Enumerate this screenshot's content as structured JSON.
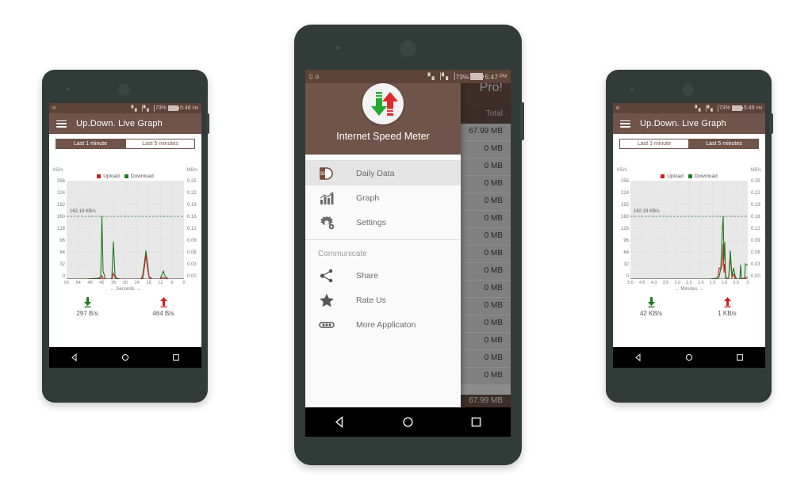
{
  "page": {
    "background": "#ffffff"
  },
  "colors": {
    "brand_brown": "#70544a",
    "status_brown": "#5d4338",
    "upload_red": "#cc2127",
    "download_green": "#1f7a1f",
    "plot_bg": "#e8e8e8",
    "phone_body": "#313b38"
  },
  "phones": [
    {
      "id": "left",
      "statusbar": {
        "battery_percent": "73%",
        "time": "5:48",
        "meridiem": "PM",
        "icons": [
          "upload-status-icon",
          "signal-icon",
          "signal-icon",
          "battery-icon"
        ]
      },
      "appbar": {
        "title": "Up.Down. Live Graph",
        "menu_icon": "hamburger-icon"
      },
      "tabs": [
        {
          "label": "Last 1 minute",
          "active": true
        },
        {
          "label": "Last 5 minutes",
          "active": false
        }
      ],
      "chart": {
        "left_unit": "KB/s",
        "right_unit": "MB/s",
        "legend": [
          {
            "label": "Upload",
            "color": "#cc2127"
          },
          {
            "label": "Download",
            "color": "#1f7a1f"
          }
        ],
        "peak_label": "162.19 KB/s",
        "xlabel": "← Seconds →",
        "y_left_ticks": [
          "256",
          "224",
          "192",
          "160",
          "128",
          "96",
          "64",
          "32",
          "0"
        ],
        "y_right_ticks": [
          "0.25",
          "0.22",
          "0.19",
          "0.16",
          "0.12",
          "0.09",
          "0.06",
          "0.03",
          "0.00"
        ],
        "x_ticks": [
          "60",
          "54",
          "48",
          "42",
          "36",
          "30",
          "24",
          "18",
          "12",
          "6",
          "0"
        ]
      },
      "stats": [
        {
          "kind": "download",
          "icon": "download-arrow-icon",
          "value": "297 B/s"
        },
        {
          "kind": "upload",
          "icon": "upload-arrow-icon",
          "value": "464 B/s"
        }
      ],
      "chart_data_ref": 0
    },
    {
      "id": "center",
      "statusbar": {
        "battery_percent": "73%",
        "time": "5:47",
        "meridiem": "PM",
        "icons": [
          "sd-card-icon",
          "upload-status-icon",
          "signal-icon",
          "signal-icon",
          "battery-icon"
        ]
      },
      "background_screen": {
        "appbar_title": "Pro!",
        "table_header": "Total",
        "rows": [
          "67.99 MB",
          "0 MB",
          "0 MB",
          "0 MB",
          "0 MB",
          "0 MB",
          "0 MB",
          "0 MB",
          "0 MB",
          "0 MB",
          "0 MB",
          "0 MB",
          "0 MB",
          "0 MB",
          "0 MB"
        ],
        "footer_total": "67.99 MB"
      },
      "drawer": {
        "logo_icon": "internet-speed-meter-logo",
        "title": "Internet Speed Meter",
        "items": [
          {
            "label": "Daily Data",
            "icon": "daily-data-icon",
            "selected": true
          },
          {
            "label": "Graph",
            "icon": "bar-chart-icon",
            "selected": false
          },
          {
            "label": "Settings",
            "icon": "gear-icon",
            "selected": false
          }
        ],
        "section_label": "Communicate",
        "communicate_items": [
          {
            "label": "Share",
            "icon": "share-icon"
          },
          {
            "label": "Rate Us",
            "icon": "star-icon"
          },
          {
            "label": "More Applicaton",
            "icon": "more-apps-icon"
          }
        ]
      }
    },
    {
      "id": "right",
      "statusbar": {
        "battery_percent": "73%",
        "time": "5:49",
        "meridiem": "PM",
        "icons": [
          "upload-status-icon",
          "signal-icon",
          "signal-icon",
          "battery-icon"
        ]
      },
      "appbar": {
        "title": "Up.Down. Live Graph",
        "menu_icon": "hamburger-icon"
      },
      "tabs": [
        {
          "label": "Last 1 minute",
          "active": false
        },
        {
          "label": "Last 5 minutes",
          "active": true
        }
      ],
      "chart": {
        "left_unit": "KB/s",
        "right_unit": "MB/s",
        "legend": [
          {
            "label": "Upload",
            "color": "#cc2127"
          },
          {
            "label": "Download",
            "color": "#1f7a1f"
          }
        ],
        "peak_label": "162.19 KB/s",
        "xlabel": "← Minutes →",
        "y_left_ticks": [
          "256",
          "224",
          "192",
          "160",
          "128",
          "96",
          "64",
          "32",
          "0"
        ],
        "y_right_ticks": [
          "0.25",
          "0.22",
          "0.19",
          "0.16",
          "0.12",
          "0.09",
          "0.06",
          "0.03",
          "0.00"
        ],
        "x_ticks": [
          "5.0",
          "4.5",
          "4.0",
          "3.5",
          "3.0",
          "2.5",
          "2.0",
          "1.5",
          "1.0",
          "0.5",
          "0"
        ]
      },
      "stats": [
        {
          "kind": "download",
          "icon": "download-arrow-icon",
          "value": "42 KB/s"
        },
        {
          "kind": "upload",
          "icon": "upload-arrow-icon",
          "value": "1 KB/s"
        }
      ],
      "chart_data_ref": 1
    }
  ],
  "chart_data": [
    {
      "type": "line",
      "title": "Up.Down. Live Graph — Last 1 minute",
      "xlabel": "← Seconds →",
      "ylabel": "KB/s",
      "ylabel_right": "MB/s",
      "xlim": [
        60,
        0
      ],
      "ylim": [
        0,
        256
      ],
      "ylim_right": [
        0.0,
        0.25
      ],
      "grid": true,
      "legend_position": "top-center",
      "annotations": [
        {
          "text": "162.19 KB/s",
          "y": 162.19,
          "style": "dashed-green-line"
        }
      ],
      "yticks": [
        0,
        32,
        64,
        96,
        128,
        160,
        192,
        224,
        256
      ],
      "yticks_right": [
        0.0,
        0.03,
        0.06,
        0.09,
        0.12,
        0.19,
        0.22,
        0.25
      ],
      "xticks": [
        60,
        54,
        48,
        42,
        36,
        30,
        24,
        18,
        12,
        6,
        0
      ],
      "series": [
        {
          "name": "Download",
          "color": "#1f7a1f",
          "x": [
            60,
            50,
            44,
            42,
            41.5,
            41,
            40,
            37,
            36,
            35.5,
            35,
            33,
            25,
            21,
            20,
            19,
            18,
            16,
            13,
            11,
            10,
            9,
            6,
            3,
            0
          ],
          "values": [
            0,
            0,
            0,
            2,
            162,
            20,
            0,
            2,
            96,
            10,
            1,
            0,
            0,
            4,
            40,
            74,
            40,
            6,
            0,
            5,
            9,
            4,
            0,
            0,
            0
          ]
        },
        {
          "name": "Upload",
          "color": "#cc2127",
          "x": [
            60,
            50,
            44,
            42,
            41.5,
            41,
            40,
            37,
            36,
            35.5,
            35,
            33,
            25,
            21,
            20,
            19,
            18,
            16,
            13,
            11,
            10,
            9,
            6,
            3,
            0
          ],
          "values": [
            0,
            0,
            0,
            1,
            9,
            3,
            0,
            1,
            14,
            4,
            0,
            0,
            0,
            2,
            28,
            62,
            26,
            3,
            0,
            1,
            2,
            1,
            0,
            0,
            0
          ]
        }
      ]
    },
    {
      "type": "line",
      "title": "Up.Down. Live Graph — Last 5 minutes",
      "xlabel": "← Minutes →",
      "ylabel": "KB/s",
      "ylabel_right": "MB/s",
      "xlim": [
        5.0,
        0
      ],
      "ylim": [
        0,
        256
      ],
      "ylim_right": [
        0.0,
        0.25
      ],
      "grid": true,
      "legend_position": "top-center",
      "annotations": [
        {
          "text": "162.19 KB/s",
          "y": 162.19,
          "style": "dashed-green-line"
        }
      ],
      "yticks": [
        0,
        32,
        64,
        96,
        128,
        160,
        192,
        224,
        256
      ],
      "yticks_right": [
        0.0,
        0.03,
        0.06,
        0.09,
        0.12,
        0.19,
        0.22,
        0.25
      ],
      "xticks": [
        5.0,
        4.5,
        4.0,
        3.5,
        3.0,
        2.5,
        2.0,
        1.5,
        1.0,
        0.5,
        0
      ],
      "series": [
        {
          "name": "Download",
          "color": "#1f7a1f",
          "x": [
            5.0,
            4.0,
            3.0,
            2.0,
            1.25,
            1.12,
            1.05,
            1.0,
            0.95,
            0.9,
            0.82,
            0.75,
            0.68,
            0.62,
            0.55,
            0.5,
            0.42,
            0.3,
            0.2,
            0.1,
            0.05,
            0
          ],
          "values": [
            0,
            0,
            0,
            0,
            2,
            30,
            162,
            30,
            4,
            96,
            10,
            4,
            74,
            8,
            14,
            4,
            2,
            40,
            3,
            2,
            38,
            38
          ]
        },
        {
          "name": "Upload",
          "color": "#cc2127",
          "x": [
            5.0,
            4.0,
            3.0,
            2.0,
            1.25,
            1.12,
            1.05,
            1.0,
            0.95,
            0.9,
            0.82,
            0.75,
            0.68,
            0.62,
            0.55,
            0.5,
            0.42,
            0.3,
            0.2,
            0.1,
            0.05,
            0
          ],
          "values": [
            0,
            0,
            0,
            0,
            1,
            6,
            30,
            8,
            2,
            40,
            5,
            2,
            34,
            4,
            6,
            2,
            1,
            4,
            1,
            1,
            2,
            2
          ]
        }
      ]
    }
  ]
}
